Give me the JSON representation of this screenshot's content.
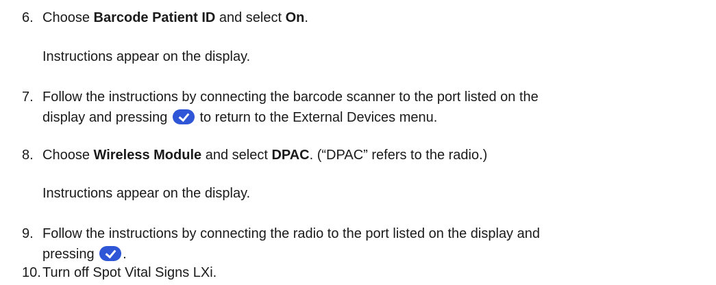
{
  "colors": {
    "text": "#1a1a1a",
    "check_button": "#2f56d6"
  },
  "steps": [
    {
      "number": "6.",
      "parts": [
        "Choose ",
        "Barcode Patient ID",
        " and select ",
        "On",
        "."
      ]
    },
    {
      "note": "Instructions appear on the display."
    },
    {
      "number": "7.",
      "line1": "Follow the instructions by connecting the barcode scanner to the port listed on the",
      "line2_pre": "display and pressing ",
      "line2_post": " to return to the External Devices menu.",
      "icon": "check-button-icon"
    },
    {
      "number": "8.",
      "parts": [
        "Choose ",
        "Wireless Module",
        " and select ",
        "DPAC",
        ". (“DPAC” refers to the radio.)"
      ]
    },
    {
      "note": "Instructions appear on the display."
    },
    {
      "number": "9.",
      "line1": "Follow the instructions by connecting the radio to the port listed on the display and",
      "line2_pre": "pressing ",
      "line2_post": ".",
      "icon": "check-button-icon"
    },
    {
      "number": "10.",
      "text": "Turn off Spot Vital Signs LXi."
    }
  ]
}
